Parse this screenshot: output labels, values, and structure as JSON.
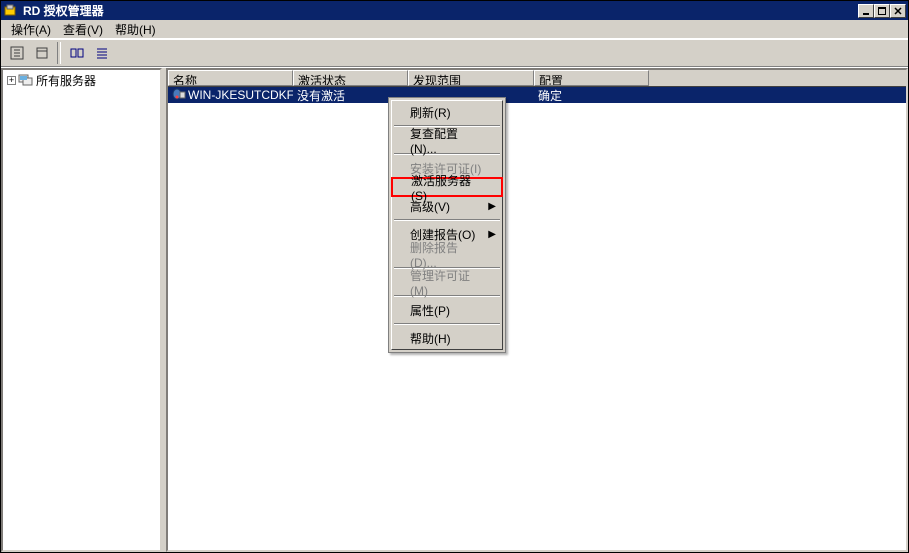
{
  "window": {
    "title": "RD 授权管理器"
  },
  "menubar": {
    "items": [
      {
        "label": "操作(A)"
      },
      {
        "label": "查看(V)"
      },
      {
        "label": "帮助(H)"
      }
    ]
  },
  "tree": {
    "root_label": "所有服务器"
  },
  "list": {
    "columns": [
      {
        "label": "名称",
        "width": 125
      },
      {
        "label": "激活状态",
        "width": 115
      },
      {
        "label": "发现范围",
        "width": 126
      },
      {
        "label": "配置",
        "width": 115
      }
    ],
    "rows": [
      {
        "name": "WIN-JKESUTCDKFE",
        "status": "没有激活",
        "scope": "",
        "config": "确定",
        "selected": true
      }
    ]
  },
  "context_menu": {
    "items": [
      {
        "label": "刷新(R)",
        "type": "item",
        "disabled": false,
        "highlighted": false
      },
      {
        "type": "sep"
      },
      {
        "label": "复查配置(N)...",
        "type": "item",
        "disabled": false,
        "highlighted": false
      },
      {
        "type": "sep"
      },
      {
        "label": "安装许可证(I)",
        "type": "item",
        "disabled": true,
        "highlighted": false
      },
      {
        "label": "激活服务器(S)",
        "type": "item",
        "disabled": false,
        "highlighted": true
      },
      {
        "label": "高级(V)",
        "type": "submenu",
        "disabled": false,
        "highlighted": false
      },
      {
        "type": "sep"
      },
      {
        "label": "创建报告(O)",
        "type": "submenu",
        "disabled": false,
        "highlighted": false
      },
      {
        "label": "删除报告(D)...",
        "type": "item",
        "disabled": true,
        "highlighted": false
      },
      {
        "type": "sep"
      },
      {
        "label": "管理许可证(M)",
        "type": "item",
        "disabled": true,
        "highlighted": false
      },
      {
        "type": "sep"
      },
      {
        "label": "属性(P)",
        "type": "item",
        "disabled": false,
        "highlighted": false
      },
      {
        "type": "sep"
      },
      {
        "label": "帮助(H)",
        "type": "item",
        "disabled": false,
        "highlighted": false
      }
    ]
  }
}
